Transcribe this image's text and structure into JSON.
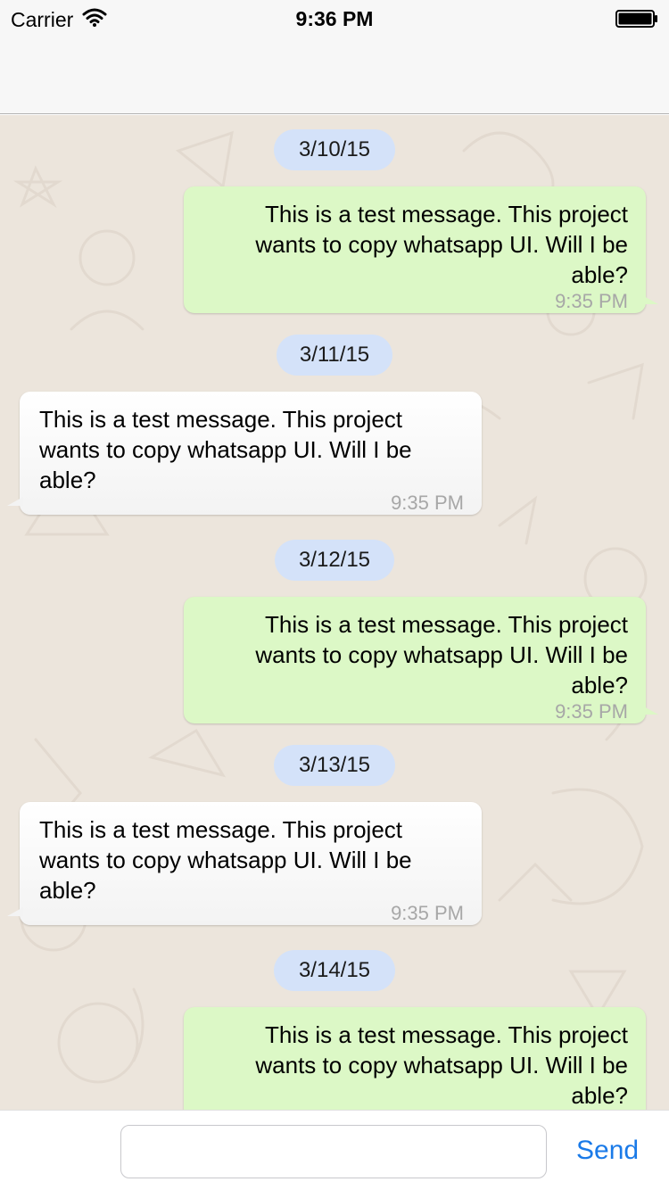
{
  "status_bar": {
    "carrier": "Carrier",
    "time": "9:36 PM",
    "icons": [
      "wifi-icon",
      "battery-icon"
    ]
  },
  "chat": {
    "messages": [
      {
        "kind": "date",
        "text": "3/10/15"
      },
      {
        "kind": "outgoing",
        "text": "This is a test message. This project wants to copy whatsapp UI. Will I be able?",
        "time": "9:35 PM"
      },
      {
        "kind": "date",
        "text": "3/11/15"
      },
      {
        "kind": "incoming",
        "text": "This is a test message. This project wants to copy whatsapp UI. Will I be able?",
        "time": "9:35 PM"
      },
      {
        "kind": "date",
        "text": "3/12/15"
      },
      {
        "kind": "outgoing",
        "text": "This is a test message. This project wants to copy whatsapp UI. Will I be able?",
        "time": "9:35 PM"
      },
      {
        "kind": "date",
        "text": "3/13/15"
      },
      {
        "kind": "incoming",
        "text": "This is a test message. This project wants to copy whatsapp UI. Will I be able?",
        "time": "9:35 PM"
      },
      {
        "kind": "date",
        "text": "3/14/15"
      },
      {
        "kind": "outgoing",
        "text": "This is a test message. This project wants to copy whatsapp UI. Will I be able?",
        "time": ""
      }
    ]
  },
  "input_bar": {
    "message_value": "",
    "placeholder": "",
    "send_label": "Send"
  },
  "colors": {
    "outgoing_bubble": "#dcf8c6",
    "incoming_bubble": "#ffffff",
    "date_pill": "#d4e2f9",
    "chat_background": "#ece5dc",
    "send_accent": "#1a7ae8"
  }
}
